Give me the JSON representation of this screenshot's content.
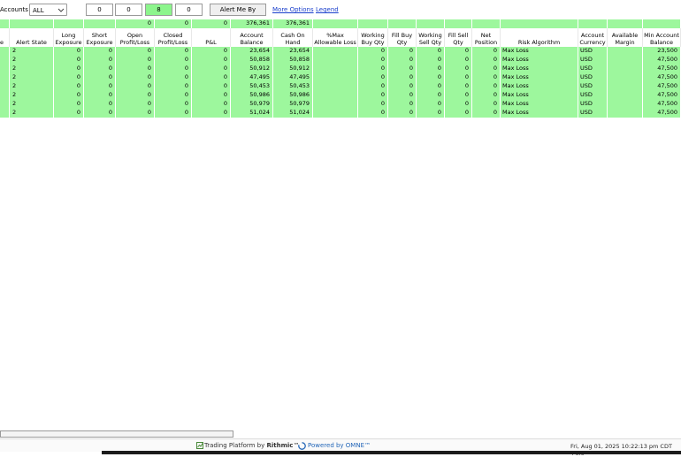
{
  "toolbar": {
    "accounts_label": "Accounts",
    "accounts_value": "ALL",
    "counters": [
      "0",
      "0",
      "8",
      "0"
    ],
    "alert_button": "Alert Me By",
    "more_options": "More Options",
    "legend": "Legend"
  },
  "colors": {
    "row_green": "#9df79d",
    "counter_green": "#8cf58c",
    "link": "#1a3fcc"
  },
  "totals": {
    "open_pl": "0",
    "closed_pl": "0",
    "pnl": "0",
    "account_balance": "376,361",
    "cash_on_hand": "376,361"
  },
  "columns": [
    "e",
    "Alert State",
    "Long Exposure",
    "Short Exposure",
    "Open Profit/Loss",
    "Closed Profit/Loss",
    "P&L",
    "Account Balance",
    "Cash On Hand",
    "%Max Allowable Loss",
    "Working Buy Qty",
    "Fill Buy Qty",
    "Working Sell Qty",
    "Fill Sell Qty",
    "Net Position",
    "Risk Algorithm",
    "Account Currency",
    "Available Margin",
    "Min Account Balance"
  ],
  "rows": [
    [
      "2",
      "0",
      "0",
      "0",
      "0",
      "0",
      "23,654",
      "23,654",
      "",
      "0",
      "0",
      "0",
      "0",
      "0",
      "Max Loss",
      "USD",
      "",
      "23,500"
    ],
    [
      "2",
      "0",
      "0",
      "0",
      "0",
      "0",
      "50,858",
      "50,858",
      "",
      "0",
      "0",
      "0",
      "0",
      "0",
      "Max Loss",
      "USD",
      "",
      "47,500"
    ],
    [
      "2",
      "0",
      "0",
      "0",
      "0",
      "0",
      "50,912",
      "50,912",
      "",
      "0",
      "0",
      "0",
      "0",
      "0",
      "Max Loss",
      "USD",
      "",
      "47,500"
    ],
    [
      "2",
      "0",
      "0",
      "0",
      "0",
      "0",
      "47,495",
      "47,495",
      "",
      "0",
      "0",
      "0",
      "0",
      "0",
      "Max Loss",
      "USD",
      "",
      "47,500"
    ],
    [
      "2",
      "0",
      "0",
      "0",
      "0",
      "0",
      "50,453",
      "50,453",
      "",
      "0",
      "0",
      "0",
      "0",
      "0",
      "Max Loss",
      "USD",
      "",
      "47,500"
    ],
    [
      "2",
      "0",
      "0",
      "0",
      "0",
      "0",
      "50,986",
      "50,986",
      "",
      "0",
      "0",
      "0",
      "0",
      "0",
      "Max Loss",
      "USD",
      "",
      "47,500"
    ],
    [
      "2",
      "0",
      "0",
      "0",
      "0",
      "0",
      "50,979",
      "50,979",
      "",
      "0",
      "0",
      "0",
      "0",
      "0",
      "Max Loss",
      "USD",
      "",
      "47,500"
    ],
    [
      "2",
      "0",
      "0",
      "0",
      "0",
      "0",
      "51,024",
      "51,024",
      "",
      "0",
      "0",
      "0",
      "0",
      "0",
      "Max Loss",
      "USD",
      "",
      "47,500"
    ]
  ],
  "status": {
    "trading_platform": "Trading Platform by",
    "rithmic": "Rithmic",
    "powered_by": "Powered by OMNE",
    "datetime": "Fri, Aug 01, 2025 10:22:13 pm CDT +0.0"
  }
}
